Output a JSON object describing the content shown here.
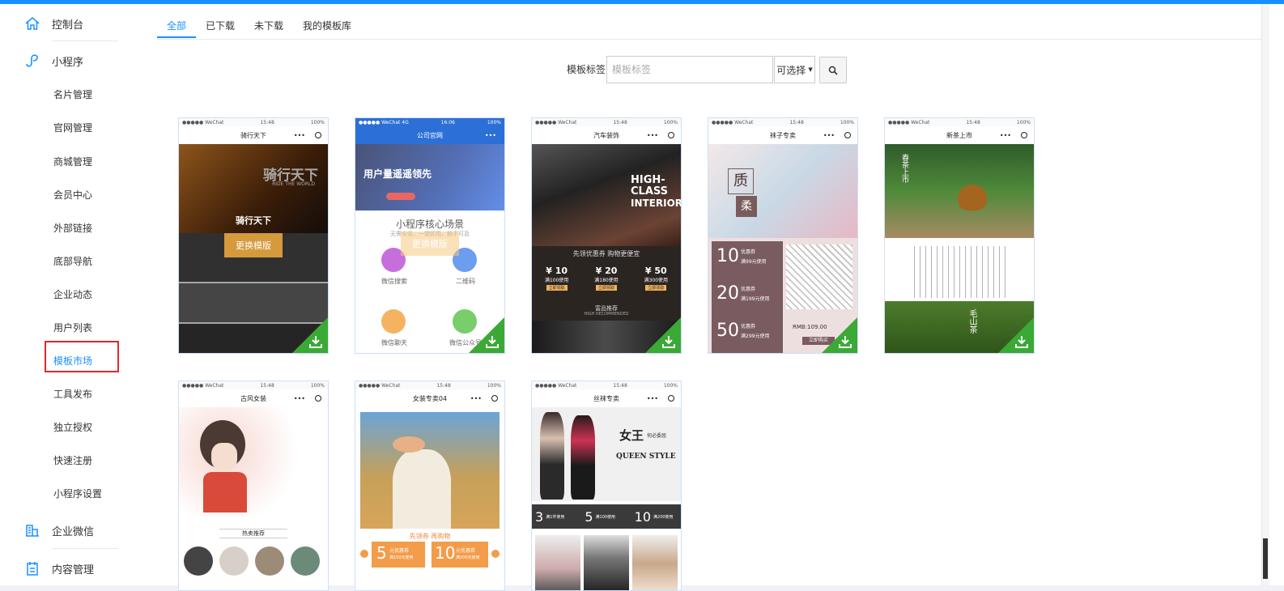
{
  "sidebar": {
    "console": "控制台",
    "miniprogram": "小程序",
    "items": [
      "名片管理",
      "官网管理",
      "商城管理",
      "会员中心",
      "外部链接",
      "底部导航",
      "企业动态",
      "用户列表",
      "模板市场",
      "工具发布",
      "独立授权",
      "快速注册",
      "小程序设置"
    ],
    "selected": "模板市场",
    "enterprise_wechat": "企业微信",
    "content_manage": "内容管理"
  },
  "tabs": [
    "全部",
    "已下载",
    "未下载",
    "我的模板库"
  ],
  "active_tab": "全部",
  "filter": {
    "label": "模板标签：",
    "placeholder": "模板标签",
    "select_value": "可选择"
  },
  "accent_color": "#1890ff",
  "templates": [
    {
      "status_left": "●●●●● WeChat",
      "time": "15:48",
      "battery": "100%",
      "title": "骑行天下",
      "banner": "骑行天下",
      "banner_sub": "RIDE THE WORLD",
      "overlay_title": "骑行天下",
      "overlay_button": "更换模版",
      "has_overlay": true
    },
    {
      "status_left": "●●●●● WeChat 4G",
      "time": "16:06",
      "battery": "100%",
      "title": "公司官网",
      "banner": "用户量遥遥领先",
      "section": "小程序核心场景",
      "section_sub": "无需安装，一键即用，触手可及",
      "overlay_button": "更换模版",
      "feature1": "微信搜索",
      "feature2": "二维码",
      "feature3": "微信聊天",
      "feature4": "微信公众号",
      "has_overlay": true
    },
    {
      "status_left": "●●●●● WeChat",
      "time": "15:48",
      "battery": "100%",
      "title": "汽车装饰",
      "banner1": "HIGH-",
      "banner2": "CLASS",
      "banner3": "INTERIOR",
      "slogan": "先领优惠券 购物更便宜",
      "coupons": [
        "¥ 10",
        "¥ 20",
        "¥ 50"
      ],
      "coupon_cond": [
        "满100使用",
        "满180使用",
        "满300使用"
      ],
      "coupon_btn": "立即领取",
      "rec": "富品推荐",
      "rec_sub": "HIGH RECOMMENDED"
    },
    {
      "status_left": "●●●●● WeChat",
      "time": "15:48",
      "battery": "100%",
      "title": "袜子专卖",
      "tag1": "质",
      "tag2": "柔",
      "coupons": [
        "10",
        "20",
        "50"
      ],
      "coupon_label": "优惠券",
      "coupon_cond": [
        "满99元使用",
        "满199元使用",
        "满299元使用"
      ],
      "price": "RMB:109.00",
      "buy": "立即购买"
    },
    {
      "status_left": "●●●●● WeChat",
      "time": "15:48",
      "battery": "100%",
      "title": "新茶上市",
      "banner": "春茶上市",
      "tea_label": "毛山茶"
    },
    {
      "status_left": "●●●●● WeChat",
      "time": "15:48",
      "battery": "100%",
      "title": "古风女装",
      "rec": "热卖推荐"
    },
    {
      "status_left": "●●●●● WeChat",
      "time": "15:48",
      "battery": "100%",
      "title": "女装专卖04",
      "slogan": "先领券 再购物",
      "coupons": [
        "5",
        "10"
      ],
      "coupon_label": "元优惠券",
      "coupon_cond": [
        "满100元使用",
        "满200元使用"
      ]
    },
    {
      "status_left": "●●●●● WeChat",
      "time": "15:48",
      "battery": "100%",
      "title": "丝袜专卖",
      "banner": "女王",
      "banner_small": "何必委屈",
      "banner_en": "QUEEN STYLE",
      "coupons": [
        "3",
        "5",
        "10"
      ],
      "coupon_cond": [
        "满1件使用",
        "满100使用",
        "满200使用"
      ]
    }
  ]
}
